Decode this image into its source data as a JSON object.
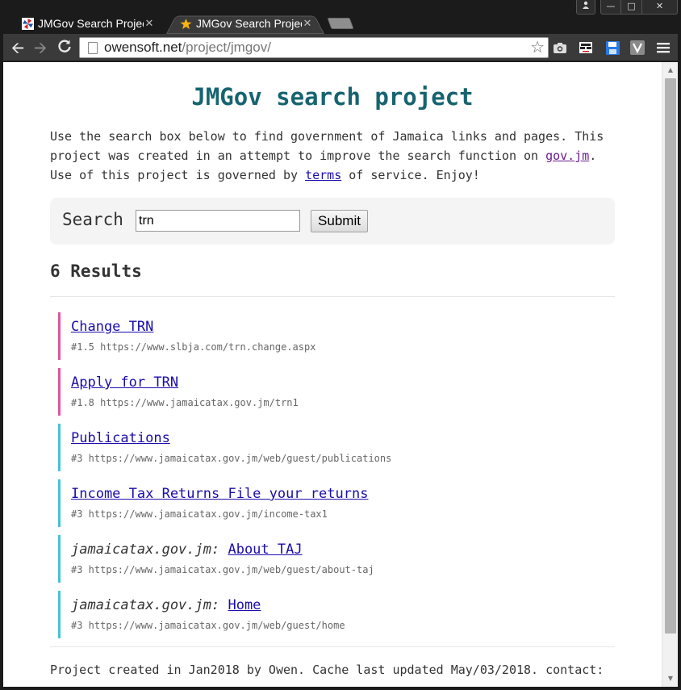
{
  "browser": {
    "tabs": [
      {
        "title": "JMGov Search Project",
        "favicon": "pinwheel-icon",
        "active": false
      },
      {
        "title": "JMGov Search Project",
        "favicon": "star-icon",
        "active": true
      }
    ],
    "address": {
      "host": "owensoft.net",
      "path": "/project/jmgov/"
    }
  },
  "page": {
    "title": "JMGov search project",
    "intro": {
      "part1": "Use the search box below to find government of Jamaica links and pages. This project was created in an attempt to improve the search function on ",
      "link1": "gov.jm",
      "part2": ". Use of this project is governed by ",
      "link2": "terms",
      "part3": " of service. Enjoy!"
    },
    "search": {
      "label": "Search",
      "value": "trn",
      "submit": "Submit"
    },
    "results_heading": "6 Results",
    "results": [
      {
        "prefix": "",
        "title": "Change TRN",
        "meta": "#1.5 https://www.slbja.com/trn.change.aspx",
        "color": "#e0559a"
      },
      {
        "prefix": "",
        "title": "Apply for TRN",
        "meta": "#1.8 https://www.jamaicatax.gov.jm/trn1",
        "color": "#e0559a"
      },
      {
        "prefix": "",
        "title": "Publications",
        "meta": "#3 https://www.jamaicatax.gov.jm/web/guest/publications",
        "color": "#43c3d5"
      },
      {
        "prefix": "",
        "title": "Income Tax Returns File your returns",
        "meta": "#3 https://www.jamaicatax.gov.jm/income-tax1",
        "color": "#43c3d5"
      },
      {
        "prefix": "jamaicatax.gov.jm: ",
        "title": "About TAJ",
        "meta": "#3 https://www.jamaicatax.gov.jm/web/guest/about-taj",
        "color": "#43c3d5"
      },
      {
        "prefix": "jamaicatax.gov.jm: ",
        "title": "Home",
        "meta": "#3 https://www.jamaicatax.gov.jm/web/guest/home",
        "color": "#43c3d5"
      }
    ],
    "footer": "Project created in Jan2018 by Owen. Cache last updated May/03/2018. contact:"
  }
}
